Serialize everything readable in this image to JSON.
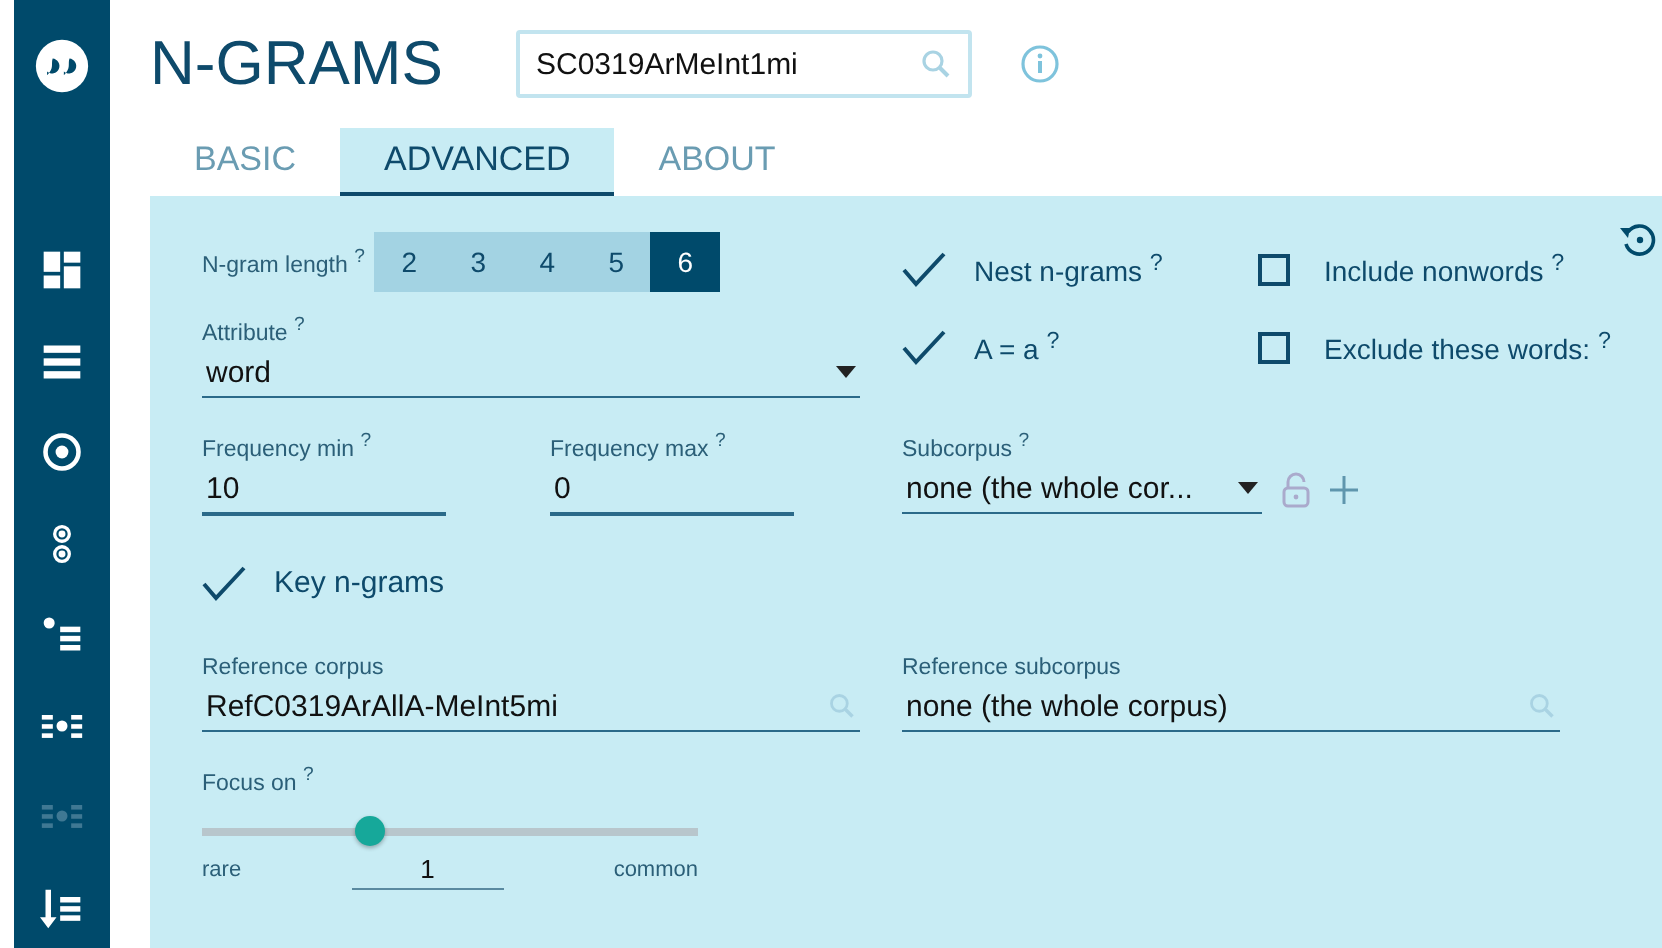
{
  "sidebar": {
    "items": [
      {
        "kind": "dashboard",
        "disabled": false
      },
      {
        "kind": "list",
        "disabled": false
      },
      {
        "kind": "target",
        "disabled": false
      },
      {
        "kind": "circles",
        "disabled": false
      },
      {
        "kind": "bullets",
        "disabled": false
      },
      {
        "kind": "dots",
        "disabled": false
      },
      {
        "kind": "dots",
        "disabled": true
      },
      {
        "kind": "sort",
        "disabled": false
      }
    ]
  },
  "header": {
    "title": "N-GRAMS",
    "corpus": "SC0319ArMeInt1mi"
  },
  "tabs": [
    {
      "label": "BASIC",
      "selected": false
    },
    {
      "label": "ADVANCED",
      "selected": true
    },
    {
      "label": "ABOUT",
      "selected": false
    }
  ],
  "ngram_length": {
    "label": "N-gram length $^{?}$",
    "options": [
      {
        "label": "2",
        "selected": false
      },
      {
        "label": "3",
        "selected": false
      },
      {
        "label": "4",
        "selected": false
      },
      {
        "label": "5",
        "selected": false
      },
      {
        "label": "6",
        "selected": true
      }
    ]
  },
  "options": [
    {
      "label": "Nest n-grams $^{?}$",
      "checked": true
    },
    {
      "label": "Include nonwords $^{?}$",
      "checked": false
    },
    {
      "label": "A = a $^{?}$",
      "checked": true
    },
    {
      "label": "Exclude these words: $^{?}$",
      "checked": false
    }
  ],
  "attribute": {
    "label": "Attribute $^{?}$",
    "value": "word"
  },
  "frequency_min": {
    "label": "Frequency min $^{?}$",
    "value": "10"
  },
  "frequency_max": {
    "label": "Frequency max $^{?}$",
    "value": "0"
  },
  "subcorpus": {
    "label": "Subcorpus $^{?}$",
    "value": "none (the whole cor..."
  },
  "key_ngrams": {
    "label": "Key n-grams",
    "checked": true
  },
  "reference_corpus": {
    "label": "Reference corpus",
    "value": "RefC0319ArAllA-MeInt5mi"
  },
  "reference_subcorpus": {
    "label": "Reference subcorpus",
    "value": "none (the whole corpus)"
  },
  "focus": {
    "label": "Focus on $^{?}$",
    "level": 0.34,
    "min_label": "rare",
    "value": "1",
    "max_label": "common"
  }
}
